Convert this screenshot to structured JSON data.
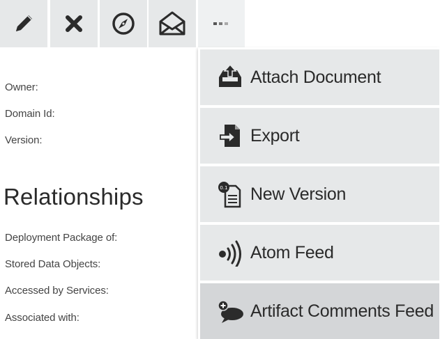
{
  "toolbar": {
    "buttons": [
      {
        "icon": "pencil-icon"
      },
      {
        "icon": "close-icon"
      },
      {
        "icon": "compass-icon"
      },
      {
        "icon": "envelope-icon"
      },
      {
        "icon": "more-icon"
      }
    ]
  },
  "details": {
    "owner_label": "Owner:",
    "domain_id_label": "Domain Id:",
    "version_label": "Version:"
  },
  "relationships": {
    "title": "Relationships",
    "items": [
      "Deployment Package of:",
      "Stored Data Objects:",
      "Accessed by Services:",
      "Associated with:"
    ]
  },
  "menu": {
    "items": [
      {
        "label": "Attach Document",
        "icon": "attach-document-icon"
      },
      {
        "label": "Export",
        "icon": "export-icon"
      },
      {
        "label": "New Version",
        "icon": "new-version-icon"
      },
      {
        "label": "Atom Feed",
        "icon": "atom-feed-icon"
      },
      {
        "label": "Artifact Comments Feed",
        "icon": "comments-feed-icon"
      }
    ],
    "active_item": "Artifact Comments Feed"
  },
  "colors": {
    "button_bg": "#e6e8e9",
    "active_bg": "#d4d6d8",
    "icon": "#2b2b2b"
  }
}
